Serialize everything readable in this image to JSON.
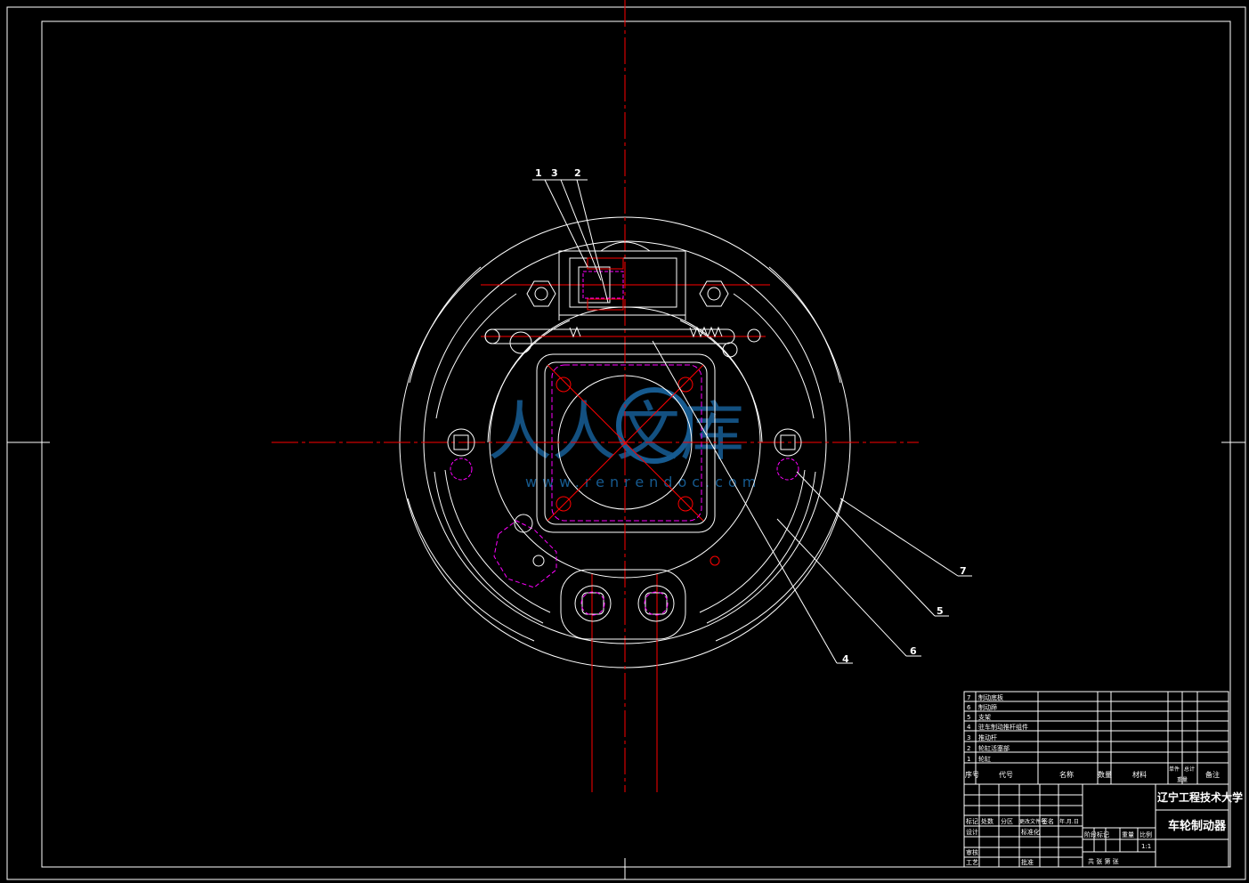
{
  "callouts": {
    "c1": "1",
    "c2": "2",
    "c3": "3",
    "c4": "4",
    "c5": "5",
    "c6": "6",
    "c7": "7"
  },
  "watermark": {
    "text": "人人文库",
    "url": "www.renrendoc.com"
  },
  "parts_list": {
    "rows": [
      {
        "no": "7",
        "name": "制动底板"
      },
      {
        "no": "6",
        "name": "制动蹄"
      },
      {
        "no": "5",
        "name": "支架"
      },
      {
        "no": "4",
        "name": "驻车制动推杆组件"
      },
      {
        "no": "3",
        "name": "推动杆"
      },
      {
        "no": "2",
        "name": "轮缸活塞部"
      },
      {
        "no": "1",
        "name": "轮缸"
      }
    ],
    "header": {
      "seq": "序号",
      "code": "代号",
      "name": "名称",
      "qty": "数量",
      "material": "材料",
      "unit_weight": "单件",
      "total_weight": "总计",
      "weight": "重量",
      "remarks": "备注"
    }
  },
  "title_block": {
    "school": "辽宁工程技术大学",
    "drawing_title": "车轮制动器",
    "rev_row": [
      "标记",
      "处数",
      "分区",
      "更改文件号",
      "签名",
      "年.月.日"
    ],
    "design": "设计",
    "standardize": "标准化",
    "review": "审核",
    "process": "工艺",
    "approve": "批准",
    "stage_label": "阶段标记",
    "weight_label": "重量",
    "scale_label": "比例",
    "scale": "1:1",
    "sheets": "共 张 第 张"
  },
  "colors": {
    "outline": "#ffffff",
    "centerline": "#ff0000",
    "hidden": "#ff00ff",
    "watermark": "#1a6aa8"
  }
}
